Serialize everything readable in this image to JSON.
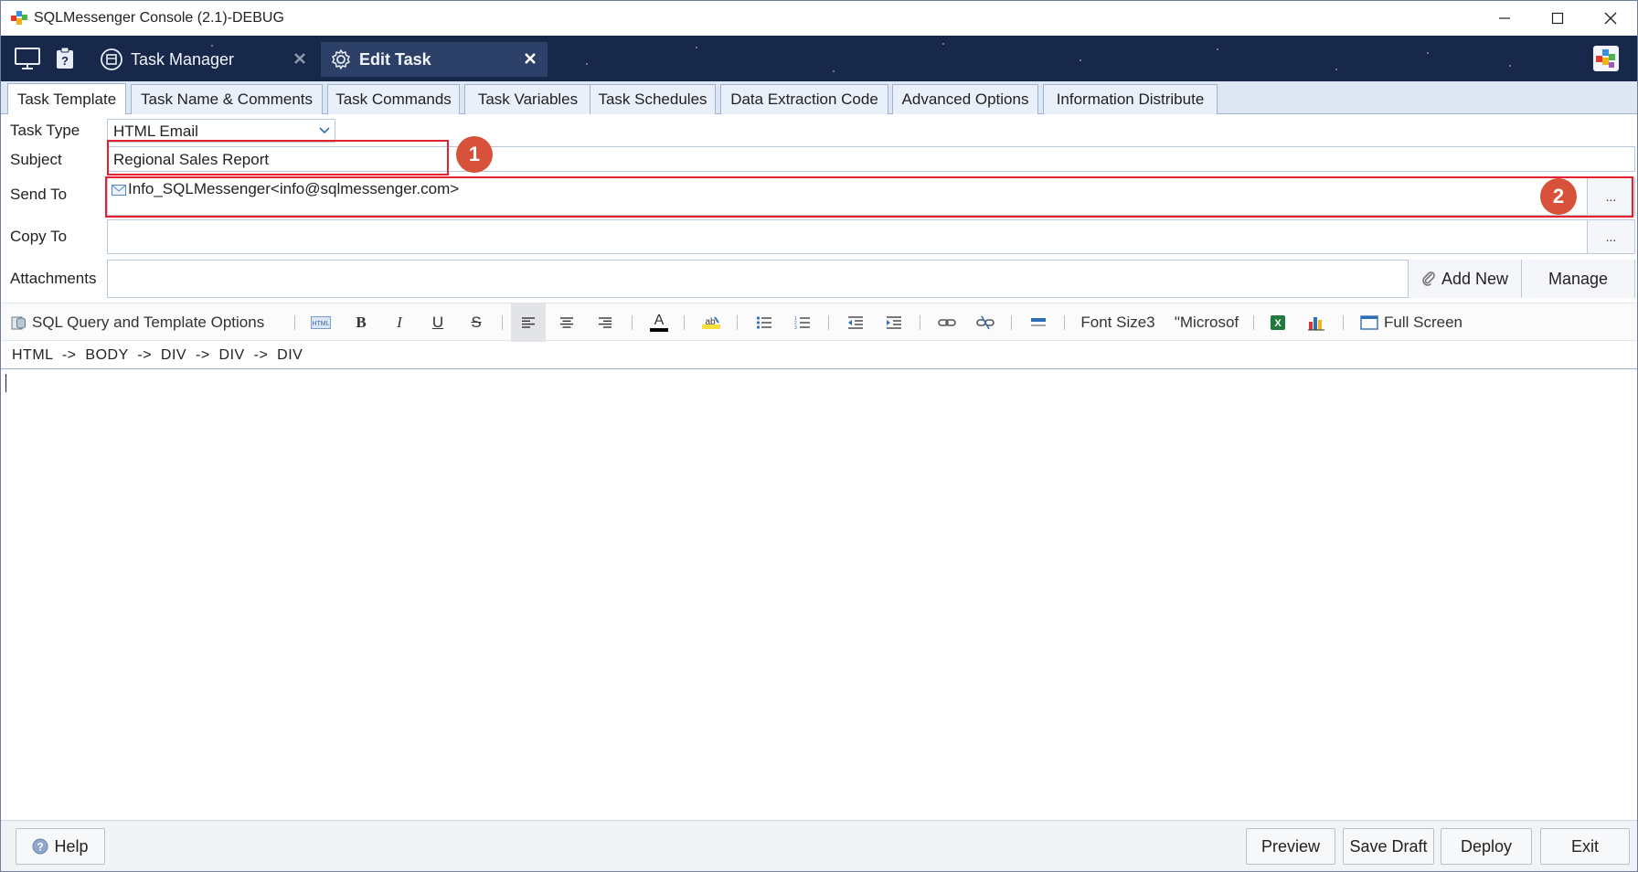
{
  "window": {
    "title": "SQLMessenger Console (2.1)-DEBUG"
  },
  "header": {
    "icons": [
      "monitor-icon",
      "help-icon",
      "app-logo-icon"
    ],
    "doc_tabs": [
      {
        "label": "Task Manager",
        "icon": "task-manager-icon",
        "active": false
      },
      {
        "label": "Edit Task",
        "icon": "gear-icon",
        "active": true
      }
    ]
  },
  "prop_tabs": [
    {
      "label": "Task Template",
      "active": true
    },
    {
      "label": "Task Name & Comments",
      "active": false
    },
    {
      "label": "Task Commands",
      "active": false
    },
    {
      "label": "Task Variables",
      "active": false
    },
    {
      "label": "Task Schedules",
      "active": false
    },
    {
      "label": "Data Extraction Code",
      "active": false
    },
    {
      "label": "Advanced Options",
      "active": false
    },
    {
      "label": "Information Distribute",
      "active": false
    }
  ],
  "form": {
    "task_type_label": "Task Type",
    "task_type_value": "HTML Email",
    "subject_label": "Subject",
    "subject_value": "Regional Sales Report",
    "send_to_label": "Send To",
    "send_to_value": "Info_SQLMessenger<info@sqlmessenger.com>",
    "copy_to_label": "Copy To",
    "copy_to_value": "",
    "attachments_label": "Attachments",
    "ellipsis": "...",
    "add_new_label": "Add New",
    "manage_label": "Manage"
  },
  "annotations": {
    "callout_1": "1",
    "callout_2": "2",
    "highlight_color": "#e8202d",
    "callout_color": "#d7513b"
  },
  "editor_toolbar": {
    "sql_options_label": "SQL Query and Template Options",
    "font_size_label": "Font Size3",
    "font_name_label": "\"Microsof",
    "full_screen_label": "Full Screen",
    "bold": "B",
    "italic": "I",
    "underline": "U",
    "strike": "S",
    "text_color": "A"
  },
  "breadcrumb": "HTML  ->  BODY  ->  DIV  ->  DIV  ->  DIV",
  "footer": {
    "help_label": "Help",
    "preview_label": "Preview",
    "save_draft_label": "Save Draft",
    "deploy_label": "Deploy",
    "exit_label": "Exit"
  },
  "colors": {
    "header_bg": "#17284a",
    "active_doc_tab": "#2d4068",
    "tab_strip_bg": "#dde7f4"
  }
}
